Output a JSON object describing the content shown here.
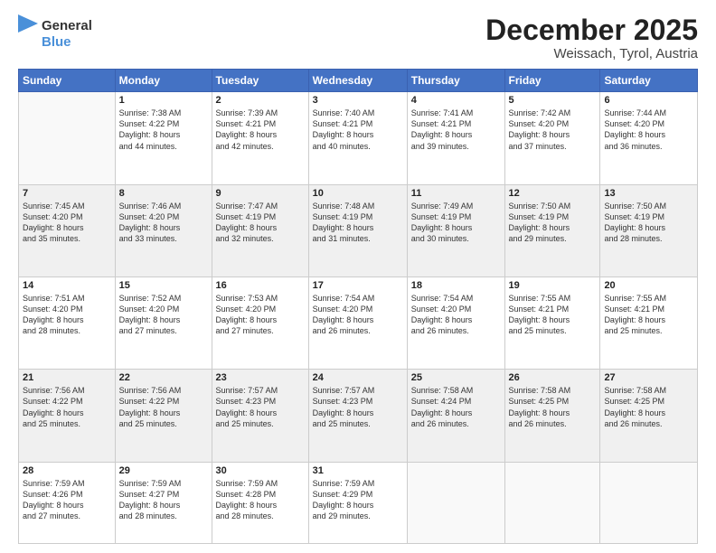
{
  "logo": {
    "general": "General",
    "blue": "Blue"
  },
  "header": {
    "month": "December 2025",
    "location": "Weissach, Tyrol, Austria"
  },
  "days_of_week": [
    "Sunday",
    "Monday",
    "Tuesday",
    "Wednesday",
    "Thursday",
    "Friday",
    "Saturday"
  ],
  "weeks": [
    [
      {
        "day": "",
        "info": ""
      },
      {
        "day": "1",
        "info": "Sunrise: 7:38 AM\nSunset: 4:22 PM\nDaylight: 8 hours\nand 44 minutes."
      },
      {
        "day": "2",
        "info": "Sunrise: 7:39 AM\nSunset: 4:21 PM\nDaylight: 8 hours\nand 42 minutes."
      },
      {
        "day": "3",
        "info": "Sunrise: 7:40 AM\nSunset: 4:21 PM\nDaylight: 8 hours\nand 40 minutes."
      },
      {
        "day": "4",
        "info": "Sunrise: 7:41 AM\nSunset: 4:21 PM\nDaylight: 8 hours\nand 39 minutes."
      },
      {
        "day": "5",
        "info": "Sunrise: 7:42 AM\nSunset: 4:20 PM\nDaylight: 8 hours\nand 37 minutes."
      },
      {
        "day": "6",
        "info": "Sunrise: 7:44 AM\nSunset: 4:20 PM\nDaylight: 8 hours\nand 36 minutes."
      }
    ],
    [
      {
        "day": "7",
        "info": "Sunrise: 7:45 AM\nSunset: 4:20 PM\nDaylight: 8 hours\nand 35 minutes."
      },
      {
        "day": "8",
        "info": "Sunrise: 7:46 AM\nSunset: 4:20 PM\nDaylight: 8 hours\nand 33 minutes."
      },
      {
        "day": "9",
        "info": "Sunrise: 7:47 AM\nSunset: 4:19 PM\nDaylight: 8 hours\nand 32 minutes."
      },
      {
        "day": "10",
        "info": "Sunrise: 7:48 AM\nSunset: 4:19 PM\nDaylight: 8 hours\nand 31 minutes."
      },
      {
        "day": "11",
        "info": "Sunrise: 7:49 AM\nSunset: 4:19 PM\nDaylight: 8 hours\nand 30 minutes."
      },
      {
        "day": "12",
        "info": "Sunrise: 7:50 AM\nSunset: 4:19 PM\nDaylight: 8 hours\nand 29 minutes."
      },
      {
        "day": "13",
        "info": "Sunrise: 7:50 AM\nSunset: 4:19 PM\nDaylight: 8 hours\nand 28 minutes."
      }
    ],
    [
      {
        "day": "14",
        "info": "Sunrise: 7:51 AM\nSunset: 4:20 PM\nDaylight: 8 hours\nand 28 minutes."
      },
      {
        "day": "15",
        "info": "Sunrise: 7:52 AM\nSunset: 4:20 PM\nDaylight: 8 hours\nand 27 minutes."
      },
      {
        "day": "16",
        "info": "Sunrise: 7:53 AM\nSunset: 4:20 PM\nDaylight: 8 hours\nand 27 minutes."
      },
      {
        "day": "17",
        "info": "Sunrise: 7:54 AM\nSunset: 4:20 PM\nDaylight: 8 hours\nand 26 minutes."
      },
      {
        "day": "18",
        "info": "Sunrise: 7:54 AM\nSunset: 4:20 PM\nDaylight: 8 hours\nand 26 minutes."
      },
      {
        "day": "19",
        "info": "Sunrise: 7:55 AM\nSunset: 4:21 PM\nDaylight: 8 hours\nand 25 minutes."
      },
      {
        "day": "20",
        "info": "Sunrise: 7:55 AM\nSunset: 4:21 PM\nDaylight: 8 hours\nand 25 minutes."
      }
    ],
    [
      {
        "day": "21",
        "info": "Sunrise: 7:56 AM\nSunset: 4:22 PM\nDaylight: 8 hours\nand 25 minutes."
      },
      {
        "day": "22",
        "info": "Sunrise: 7:56 AM\nSunset: 4:22 PM\nDaylight: 8 hours\nand 25 minutes."
      },
      {
        "day": "23",
        "info": "Sunrise: 7:57 AM\nSunset: 4:23 PM\nDaylight: 8 hours\nand 25 minutes."
      },
      {
        "day": "24",
        "info": "Sunrise: 7:57 AM\nSunset: 4:23 PM\nDaylight: 8 hours\nand 25 minutes."
      },
      {
        "day": "25",
        "info": "Sunrise: 7:58 AM\nSunset: 4:24 PM\nDaylight: 8 hours\nand 26 minutes."
      },
      {
        "day": "26",
        "info": "Sunrise: 7:58 AM\nSunset: 4:25 PM\nDaylight: 8 hours\nand 26 minutes."
      },
      {
        "day": "27",
        "info": "Sunrise: 7:58 AM\nSunset: 4:25 PM\nDaylight: 8 hours\nand 26 minutes."
      }
    ],
    [
      {
        "day": "28",
        "info": "Sunrise: 7:59 AM\nSunset: 4:26 PM\nDaylight: 8 hours\nand 27 minutes."
      },
      {
        "day": "29",
        "info": "Sunrise: 7:59 AM\nSunset: 4:27 PM\nDaylight: 8 hours\nand 28 minutes."
      },
      {
        "day": "30",
        "info": "Sunrise: 7:59 AM\nSunset: 4:28 PM\nDaylight: 8 hours\nand 28 minutes."
      },
      {
        "day": "31",
        "info": "Sunrise: 7:59 AM\nSunset: 4:29 PM\nDaylight: 8 hours\nand 29 minutes."
      },
      {
        "day": "",
        "info": ""
      },
      {
        "day": "",
        "info": ""
      },
      {
        "day": "",
        "info": ""
      }
    ]
  ]
}
